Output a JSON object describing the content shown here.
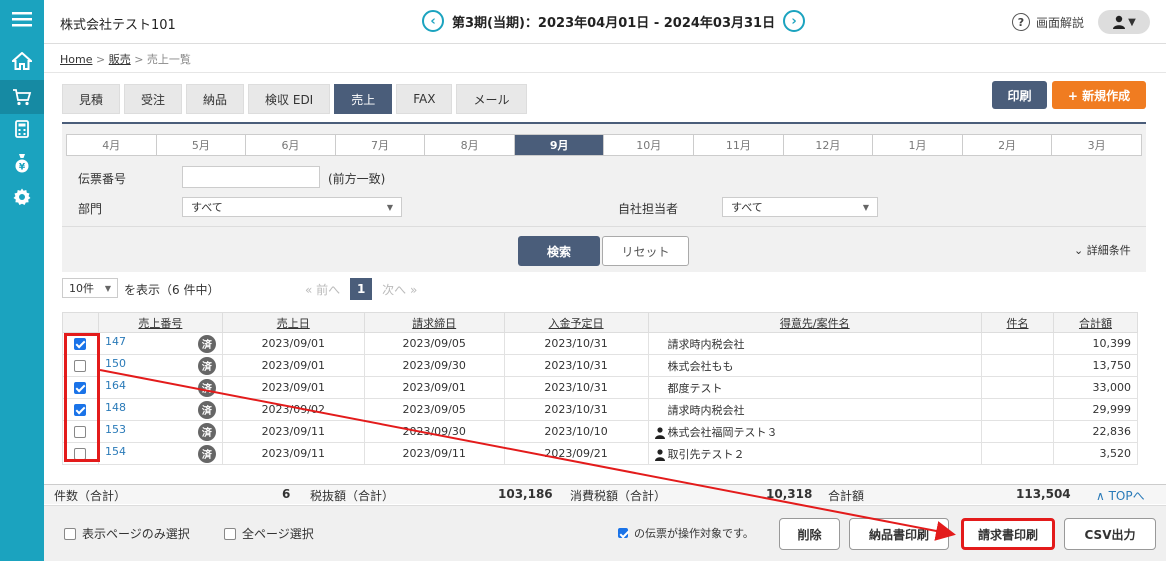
{
  "header": {
    "company": "株式会社テスト101",
    "period": "第3期(当期)：2023年04月01日 - 2024年03月31日",
    "help_label": "画面解説",
    "prev_symbol": "‹",
    "next_symbol": "›"
  },
  "breadcrumb": {
    "home": "Home",
    "sep": ">",
    "sales": "販売",
    "current": "売上一覧"
  },
  "tabs": [
    "見積",
    "受注",
    "納品",
    "検収 EDI",
    "売上",
    "FAX",
    "メール"
  ],
  "active_tab": "売上",
  "actions": {
    "print": "印刷",
    "new": "+ 新規作成"
  },
  "months": [
    "4月",
    "5月",
    "6月",
    "7月",
    "8月",
    "9月",
    "10月",
    "11月",
    "12月",
    "1月",
    "2月",
    "3月"
  ],
  "active_month": "9月",
  "filters": {
    "slip_label": "伝票番号",
    "slip_value": "",
    "slip_note": "(前方一致)",
    "dept_label": "部門",
    "dept_value": "すべて",
    "staff_label": "自社担当者",
    "staff_value": "すべて",
    "search": "検索",
    "reset": "リセット",
    "detail": "詳細条件"
  },
  "listing": {
    "per_page": "10件",
    "display_text": "を表示（6 件中）",
    "prev": "« 前へ",
    "page": "1",
    "next": "次へ »"
  },
  "table": {
    "headers": [
      "売上番号",
      "売上日",
      "請求締日",
      "入金予定日",
      "得意先/案件名",
      "件名",
      "合計額"
    ],
    "done_badge": "済",
    "rows": [
      {
        "checked": true,
        "no": "147",
        "sale_date": "2023/09/01",
        "close_date": "2023/09/05",
        "pay_date": "2023/10/31",
        "customer": "請求時内税会社",
        "person": false,
        "subject": "",
        "total": "10,399"
      },
      {
        "checked": false,
        "no": "150",
        "sale_date": "2023/09/01",
        "close_date": "2023/09/30",
        "pay_date": "2023/10/31",
        "customer": "株式会社もも",
        "person": false,
        "subject": "",
        "total": "13,750"
      },
      {
        "checked": true,
        "no": "164",
        "sale_date": "2023/09/01",
        "close_date": "2023/09/01",
        "pay_date": "2023/10/31",
        "customer": "都度テスト",
        "person": false,
        "subject": "",
        "total": "33,000"
      },
      {
        "checked": true,
        "no": "148",
        "sale_date": "2023/09/02",
        "close_date": "2023/09/05",
        "pay_date": "2023/10/31",
        "customer": "請求時内税会社",
        "person": false,
        "subject": "",
        "total": "29,999"
      },
      {
        "checked": false,
        "no": "153",
        "sale_date": "2023/09/11",
        "close_date": "2023/09/30",
        "pay_date": "2023/10/10",
        "customer": "株式会社福岡テスト３",
        "person": true,
        "subject": "",
        "total": "22,836"
      },
      {
        "checked": false,
        "no": "154",
        "sale_date": "2023/09/11",
        "close_date": "2023/09/11",
        "pay_date": "2023/09/21",
        "customer": "取引先テスト２",
        "person": true,
        "subject": "",
        "total": "3,520"
      }
    ]
  },
  "totals": {
    "count_label": "件数（合計）",
    "count": "6",
    "pretax_label": "税抜額（合計）",
    "pretax": "103,186",
    "tax_label": "消費税額（合計）",
    "tax": "10,318",
    "total_label": "合計額",
    "total": "113,504",
    "top": "∧ TOPへ"
  },
  "footer": {
    "page_only": "表示ページのみ選択",
    "all_pages": "全ページ選択",
    "target_note": "の伝票が操作対象です。",
    "delete": "削除",
    "delivery_print": "納品書印刷",
    "invoice_print": "請求書印刷",
    "csv": "CSV出力"
  },
  "colors": {
    "sidebar": "#1ba3bf",
    "primary": "#4a5d7a",
    "accent": "#f07c21",
    "annotation": "#e31b1b"
  }
}
